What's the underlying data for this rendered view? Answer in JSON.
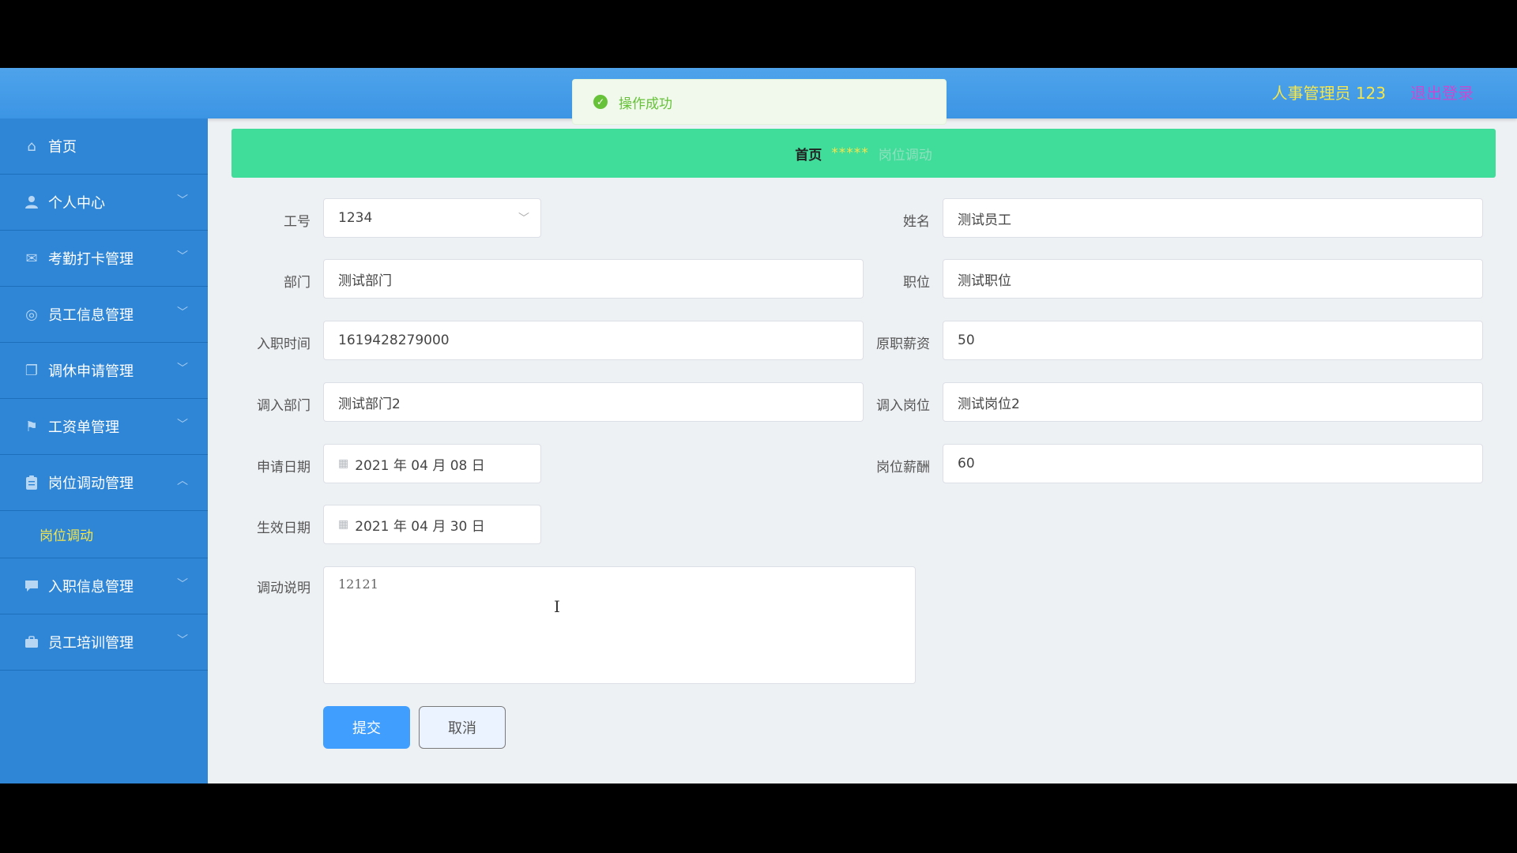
{
  "header": {
    "user": "人事管理员 123",
    "logout": "退出登录"
  },
  "toast": {
    "message": "操作成功",
    "icon": "check-circle-icon"
  },
  "sidebar": {
    "items": [
      {
        "label": "首页",
        "icon": "home-icon"
      },
      {
        "label": "个人中心",
        "icon": "user-icon"
      },
      {
        "label": "考勤打卡管理",
        "icon": "mail-icon"
      },
      {
        "label": "员工信息管理",
        "icon": "compass-icon"
      },
      {
        "label": "调休申请管理",
        "icon": "copy-icon"
      },
      {
        "label": "工资单管理",
        "icon": "flag-icon"
      },
      {
        "label": "岗位调动管理",
        "icon": "clipboard-icon"
      },
      {
        "label": "入职信息管理",
        "icon": "chat-icon"
      },
      {
        "label": "员工培训管理",
        "icon": "briefcase-icon"
      }
    ],
    "active_sub": "岗位调动"
  },
  "breadcrumb": {
    "home": "首页",
    "sep": "*****",
    "current": "岗位调动"
  },
  "form": {
    "emp_no": {
      "label": "工号",
      "value": "1234"
    },
    "name": {
      "label": "姓名",
      "value": "测试员工"
    },
    "dept": {
      "label": "部门",
      "value": "测试部门"
    },
    "position": {
      "label": "职位",
      "value": "测试职位"
    },
    "hire_time": {
      "label": "入职时间",
      "value": "1619428279000"
    },
    "orig_salary": {
      "label": "原职薪资",
      "value": "50"
    },
    "new_dept": {
      "label": "调入部门",
      "value": "测试部门2"
    },
    "new_post": {
      "label": "调入岗位",
      "value": "测试岗位2"
    },
    "apply_date": {
      "label": "申请日期",
      "value": "2021 年 04 月 08 日"
    },
    "post_salary": {
      "label": "岗位薪酬",
      "value": "60"
    },
    "effective_date": {
      "label": "生效日期",
      "value": "2021 年 04 月 30 日"
    },
    "note": {
      "label": "调动说明",
      "value": "12121"
    },
    "submit": "提交",
    "cancel": "取消"
  },
  "colors": {
    "header": "#4ea3eb",
    "sidebar": "#2f86d6",
    "breadcrumb": "#40dc9a",
    "accent_yellow": "#f4e64c",
    "primary": "#409eff"
  }
}
